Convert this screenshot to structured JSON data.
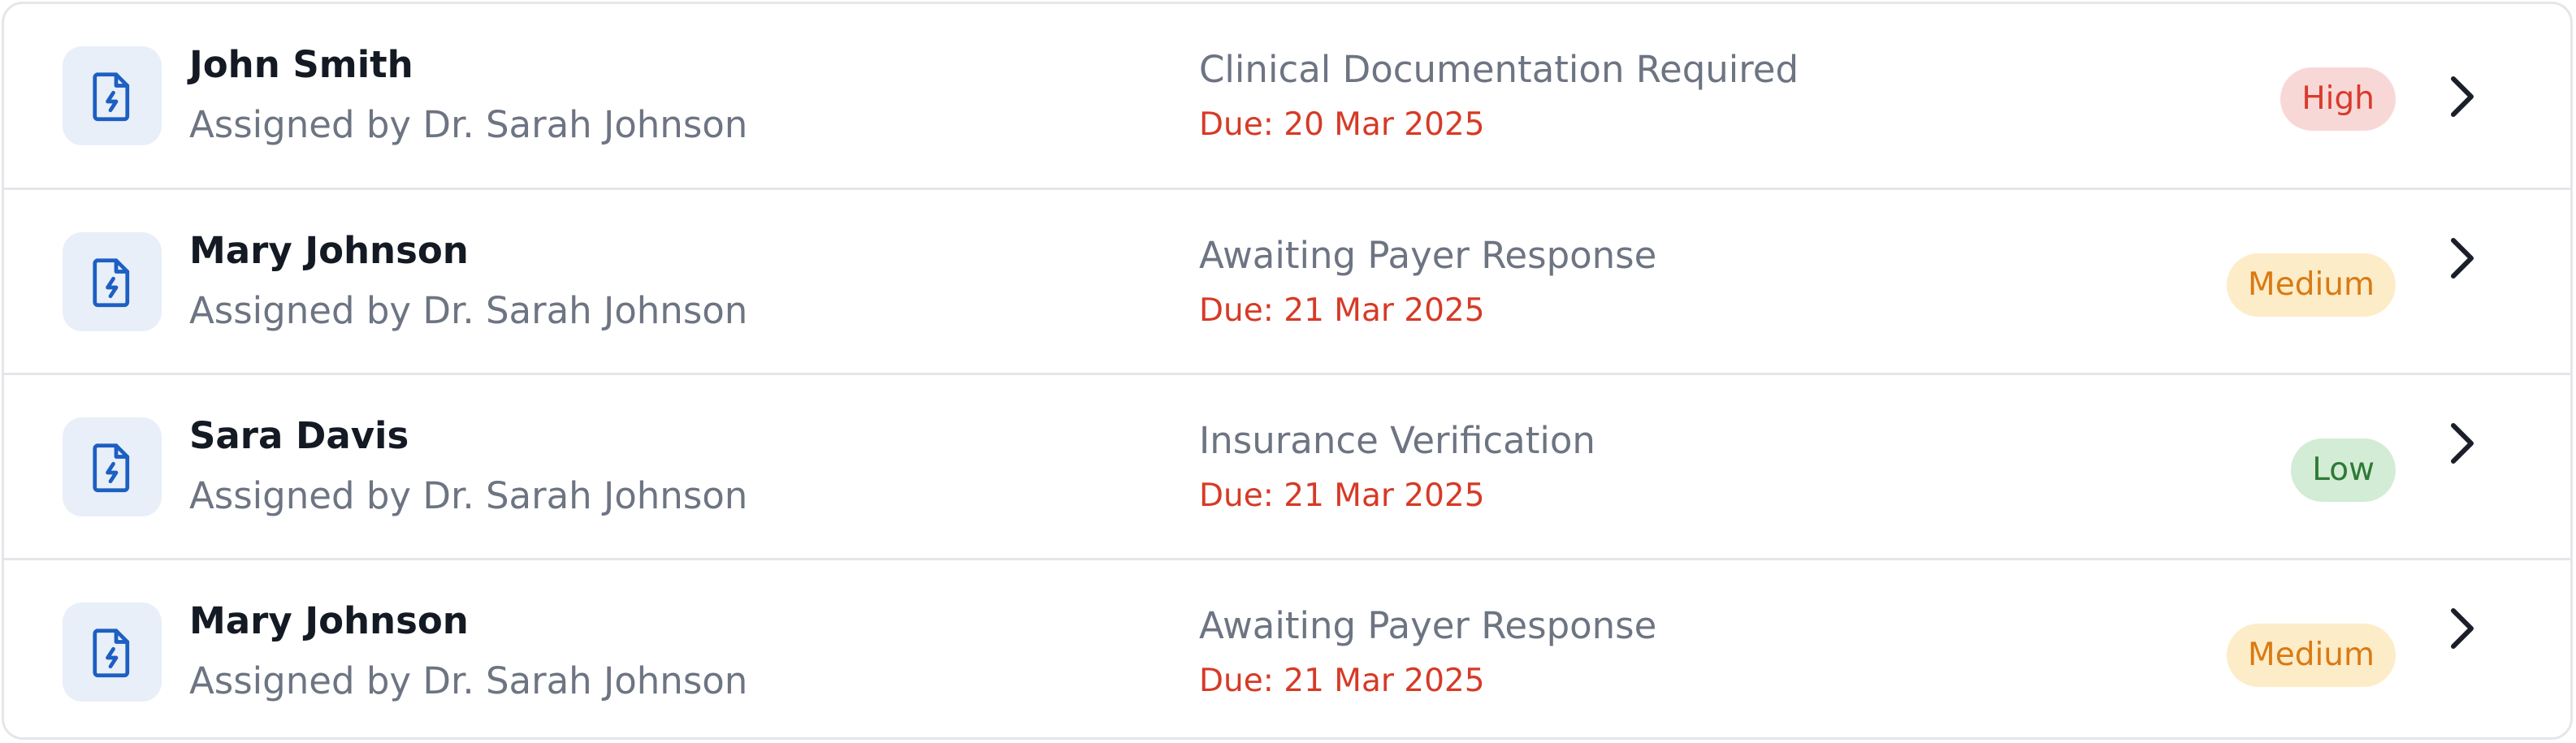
{
  "tasks": [
    {
      "name": "John Smith",
      "assigned": "Assigned by Dr. Sarah Johnson",
      "status": "Clinical Documentation Required",
      "due": "Due: 20 Mar 2025",
      "priority": "High",
      "priority_level": "high",
      "icon": "file-bolt-icon"
    },
    {
      "name": "Mary Johnson",
      "assigned": "Assigned by Dr. Sarah Johnson",
      "status": "Awaiting Payer Response",
      "due": "Due: 21 Mar 2025",
      "priority": "Medium",
      "priority_level": "medium",
      "icon": "file-bolt-icon"
    },
    {
      "name": "Sara Davis",
      "assigned": "Assigned by Dr. Sarah Johnson",
      "status": "Insurance Verification",
      "due": "Due: 21 Mar 2025",
      "priority": "Low",
      "priority_level": "low",
      "icon": "file-bolt-icon"
    },
    {
      "name": "Mary Johnson",
      "assigned": "Assigned by Dr. Sarah Johnson",
      "status": "Awaiting Payer Response",
      "due": "Due: 21 Mar 2025",
      "priority": "Medium",
      "priority_level": "medium",
      "icon": "file-bolt-icon"
    }
  ],
  "colors": {
    "icon_bg": "#e8eff8",
    "icon_stroke": "#1d5fc2",
    "due_text": "#d63a26",
    "high_bg": "#f8d8d6",
    "high_text": "#d93a2c",
    "medium_bg": "#fdecc8",
    "medium_text": "#d97a12",
    "low_bg": "#d3ecd5",
    "low_text": "#2f7a35"
  }
}
